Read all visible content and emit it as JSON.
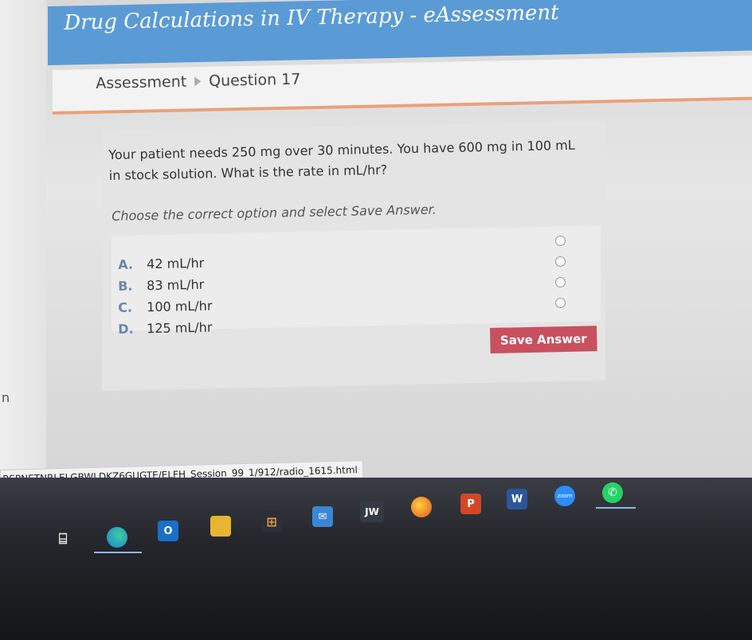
{
  "app": {
    "title": "Drug Calculations in IV Therapy - eAssessment"
  },
  "breadcrumb": {
    "root": "Assessment",
    "current": "Question 17"
  },
  "question": {
    "text": "Your patient needs 250 mg over 30 minutes. You have 600 mg in 100 mL in stock solution. What is the rate in mL/hr?",
    "instruction": "Choose the correct option and select Save Answer.",
    "options": [
      {
        "letter": "A.",
        "label": "42 mL/hr"
      },
      {
        "letter": "B.",
        "label": "83 mL/hr"
      },
      {
        "letter": "C.",
        "label": "100 mL/hr"
      },
      {
        "letter": "D.",
        "label": "125 mL/hr"
      }
    ],
    "save_label": "Save Answer"
  },
  "status_bar": {
    "url": "BSPNETNRLELGBWLDKZ6GUGTE/ELFH_Session_99_1/912/radio_1615.html"
  },
  "left_fragment": "n",
  "taskbar": {
    "jw_label": "JW",
    "outlook_label": "O",
    "powerpoint_label": "P",
    "word_label": "W",
    "zoom_label": "zoom"
  },
  "colors": {
    "header": "#5b9bd5",
    "accent_line": "#e8a27a",
    "save_button": "#c8505f"
  }
}
